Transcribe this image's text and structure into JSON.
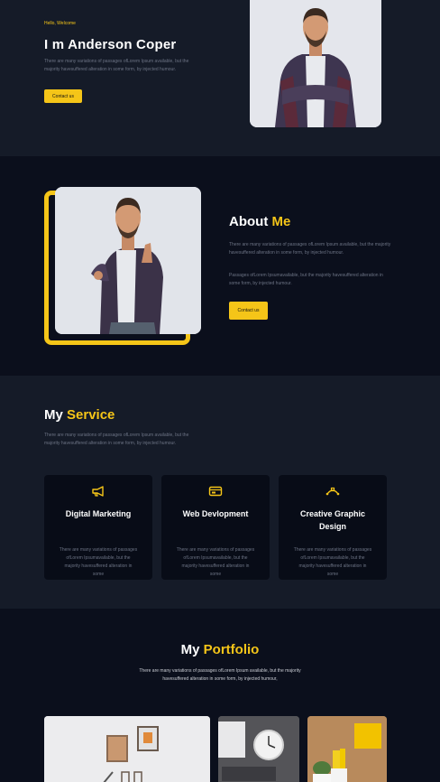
{
  "hero": {
    "greeting": "Hello, Welcome",
    "title": "I m Anderson Coper",
    "text": "There are many variations of passages ofLorem Ipsum available, but the majority havesuffered alteration in some form, by injected humour.",
    "button": "Contact us"
  },
  "about": {
    "title_main": "About",
    "title_accent": "Me",
    "para1": "There are many variations of passages ofLorem Ipsum available, but the majority havesuffered alteration in some form, by injected humour.",
    "para2": "Passages ofLorem Ipsumavailable, but the majority havesuffered alteration in some form, by injected humour.",
    "button": "Contact us"
  },
  "services": {
    "title_main": "My",
    "title_accent": "Service",
    "text": "There are many variations of passages ofLorem Ipsum available, but the majority havesuffered alteration in some form, by injected humour.",
    "cards": [
      {
        "icon": "megaphone-icon",
        "title": "Digital Marketing",
        "desc": "There are many variations of passages ofLorem Ipsumavailable, but the majority havesuffered alteration in some"
      },
      {
        "icon": "browser-icon",
        "title": "Web Devlopment",
        "desc": "There are many variations of passages ofLorem Ipsumavailable, but the majority havesuffered alteration in some"
      },
      {
        "icon": "pen-tool-icon",
        "title": "Creative Graphic Design",
        "desc": "There are many variations of passages ofLorem Ipsumavailable, but the majority havesuffered alteration in some"
      }
    ]
  },
  "portfolio": {
    "title_main": "My",
    "title_accent": "Portfolio",
    "text": "There are many variations of passages ofLorem Ipsum available, but the majority havesuffered alteration in some form, by injected humour,"
  },
  "colors": {
    "accent": "#f5c518",
    "bg_dark": "#0b0f1c",
    "bg_mid": "#151b28"
  }
}
